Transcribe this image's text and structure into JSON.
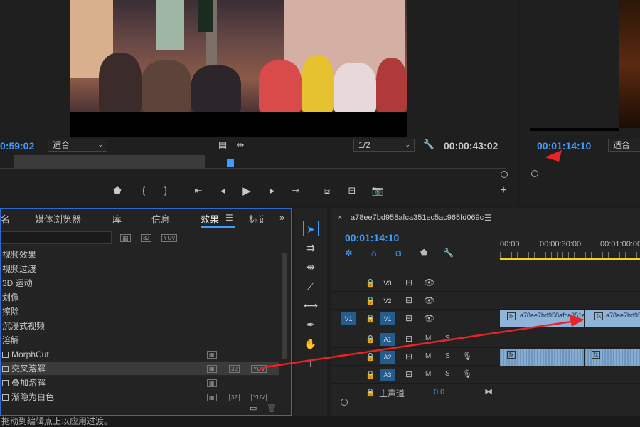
{
  "source_monitor": {
    "timecode": "0:59:02",
    "fit_label": "适合",
    "ratio_label": "1/2",
    "duration": "00:00:43:02"
  },
  "program_monitor": {
    "timecode": "00:01:14:10",
    "fit_label": "适合"
  },
  "effects_panel": {
    "tabs": [
      "名",
      "媒体浏览器",
      "库",
      "信息",
      "效果",
      "标记"
    ],
    "active_tab": "效果",
    "filter_badges": [
      "32",
      "YUV"
    ],
    "items": [
      {
        "label": "视频效果",
        "checkbox": false
      },
      {
        "label": "视频过渡",
        "checkbox": false
      },
      {
        "label": "3D 运动",
        "checkbox": false
      },
      {
        "label": "划像",
        "checkbox": false
      },
      {
        "label": "擦除",
        "checkbox": false
      },
      {
        "label": "沉浸式视频",
        "checkbox": false
      },
      {
        "label": "溶解",
        "checkbox": false
      },
      {
        "label": "MorphCut",
        "checkbox": true
      },
      {
        "label": "交叉溶解",
        "checkbox": true,
        "selected": true
      },
      {
        "label": "叠加溶解",
        "checkbox": true
      },
      {
        "label": "渐隐为白色",
        "checkbox": true
      }
    ]
  },
  "timeline": {
    "sequence_name": "a78ee7bd958afca351ec5ac965fd069c",
    "timecode": "00:01:14:10",
    "ruler": [
      "00:00",
      "00:00:30:00",
      "00:01:00:00"
    ],
    "tracks": {
      "video": [
        "V3",
        "V2",
        "V1"
      ],
      "audio": [
        "A1",
        "A2",
        "A3"
      ],
      "source_patch": "V1",
      "master_label": "主声道",
      "master_value": "0.0",
      "mute_label": "M",
      "solo_label": "S"
    },
    "clips": {
      "clip_a_name": "a78ee7bd958afca351e",
      "clip_b_name": "a78ee7bd95"
    },
    "fx_label": "fx"
  },
  "status_bar": {
    "text": "拖动到编辑点上以应用过渡。"
  },
  "colors": {
    "accent_blue": "#3e9bff",
    "panel_border": "#2e6bd1",
    "annotation_red": "#e8232a",
    "playhead_yellow": "#f5d21c"
  }
}
